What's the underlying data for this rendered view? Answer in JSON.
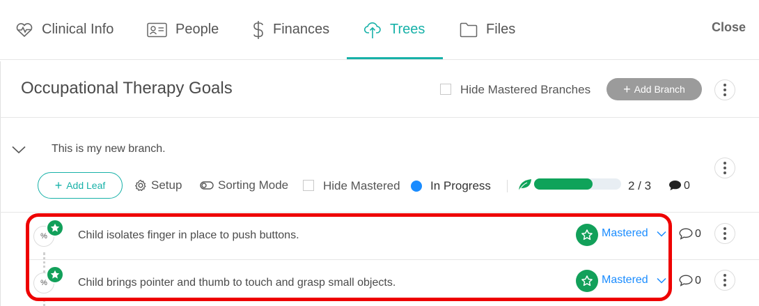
{
  "tabs": [
    {
      "label": "Clinical Info",
      "icon": "heart-pulse-icon",
      "active": false
    },
    {
      "label": "People",
      "icon": "id-card-icon",
      "active": false
    },
    {
      "label": "Finances",
      "icon": "dollar-icon",
      "active": false
    },
    {
      "label": "Trees",
      "icon": "cloud-tree-icon",
      "active": true
    },
    {
      "label": "Files",
      "icon": "folder-icon",
      "active": false
    }
  ],
  "close_label": "Close",
  "header": {
    "title": "Occupational Therapy Goals",
    "hide_mastered_branches_label": "Hide Mastered Branches",
    "add_branch_label": "Add Branch"
  },
  "branch": {
    "title": "This is my new branch.",
    "add_leaf_label": "Add Leaf",
    "setup_label": "Setup",
    "sorting_mode_label": "Sorting Mode",
    "hide_mastered_label": "Hide Mastered",
    "status_label": "In Progress",
    "progress_text": "2 / 3",
    "progress_fraction": 0.67,
    "comment_count": "0"
  },
  "leaves": [
    {
      "text": "Child isolates finger in place to push buttons.",
      "status": "Mastered",
      "comments": "0",
      "badge": "%"
    },
    {
      "text": "Child brings pointer and thumb to touch and grasp small objects.",
      "status": "Mastered",
      "comments": "0",
      "badge": "%"
    }
  ],
  "colors": {
    "accent": "#17b1a8",
    "mastered_green": "#12a05a",
    "link_blue": "#1a8cff",
    "highlight_red": "#ee0000"
  }
}
